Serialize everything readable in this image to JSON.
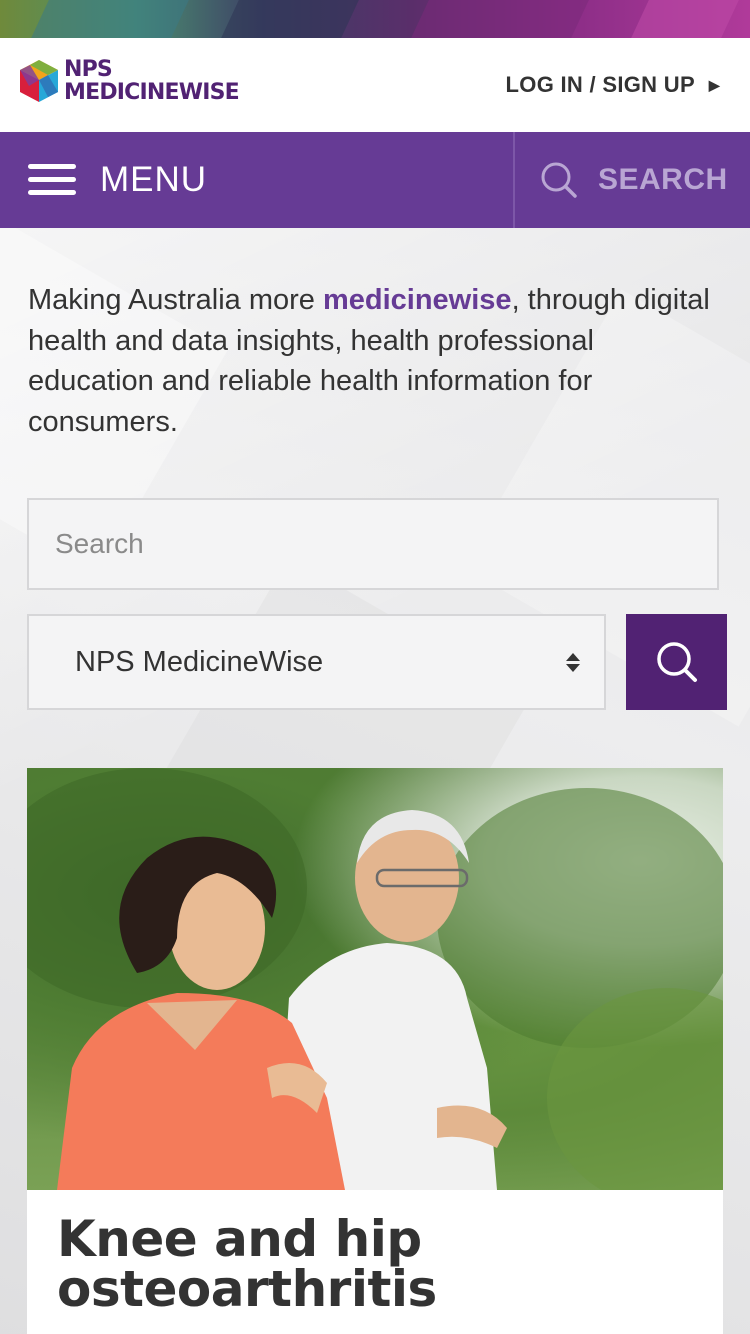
{
  "brand": {
    "logo_line1": "NPS",
    "logo_line2": "MEDICINEWISE",
    "logo_colors": [
      "#d81f3c",
      "#f3a31b",
      "#27a8d8",
      "#6ab245",
      "#7b3fa0",
      "#2f6fb5"
    ]
  },
  "header": {
    "login_label": "LOG IN / SIGN UP",
    "login_icon": "caret-right-icon"
  },
  "nav": {
    "menu_label": "MENU",
    "menu_icon": "hamburger-icon",
    "search_label": "SEARCH",
    "search_icon": "search-icon"
  },
  "intro": {
    "text_before": "Making Australia more ",
    "accent_word": "medicinewise",
    "text_after": ", through digital health and data insights, health professional education and reliable health information for consumers."
  },
  "search": {
    "placeholder": "Search",
    "value": "",
    "site_select": {
      "selected": "NPS MedicineWise",
      "icon": "select-arrows-icon"
    },
    "submit_icon": "search-icon"
  },
  "featured": {
    "image_alt": "Older couple jogging outdoors among green trees",
    "title": "Knee and hip osteoarthritis"
  },
  "colors": {
    "brand_purple": "#663b95",
    "dark_purple": "#512273",
    "text": "#333333",
    "search_accent": "#b9a6d3"
  }
}
